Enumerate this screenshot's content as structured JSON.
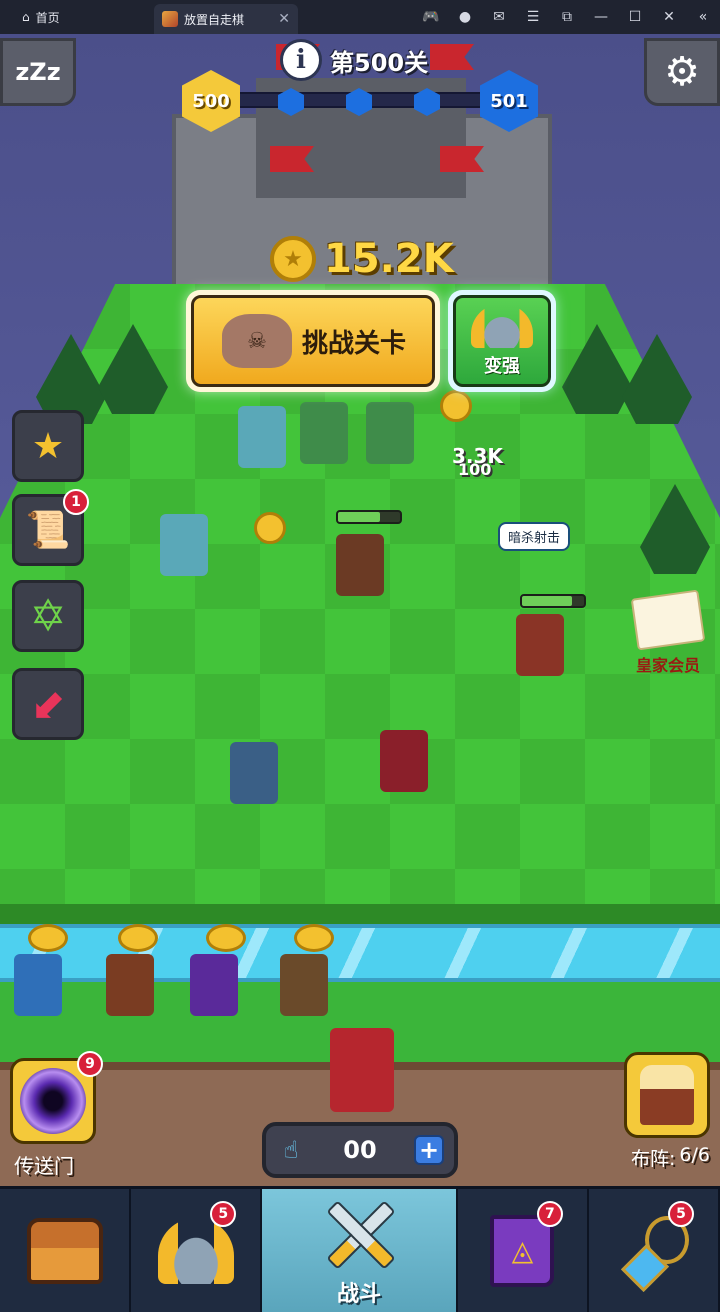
{
  "browser": {
    "home_label": "首页",
    "tab_title": "放置自走棋"
  },
  "hud": {
    "level_label": "第500关",
    "current_level": "500",
    "next_level": "501",
    "coins": "15.2K",
    "challenge_label": "挑战关卡",
    "upgrade_label": "变强"
  },
  "side": {
    "scroll_badge": "1"
  },
  "board": {
    "damage_text": "3.3K",
    "damage_sub": "100",
    "skill_tag": "暗杀射击",
    "royal_label": "皇家会员"
  },
  "bottom": {
    "portal_label": "传送门",
    "portal_badge": "9",
    "counter_value": "00",
    "formation_label": "布阵:",
    "formation_value": "6/6"
  },
  "nav": {
    "items": [
      {
        "name": "chest",
        "label": "",
        "badge": ""
      },
      {
        "name": "heroes",
        "label": "",
        "badge": "5"
      },
      {
        "name": "battle",
        "label": "战斗",
        "badge": ""
      },
      {
        "name": "spellbook",
        "label": "",
        "badge": "7"
      },
      {
        "name": "amulet",
        "label": "",
        "badge": "5"
      }
    ]
  }
}
